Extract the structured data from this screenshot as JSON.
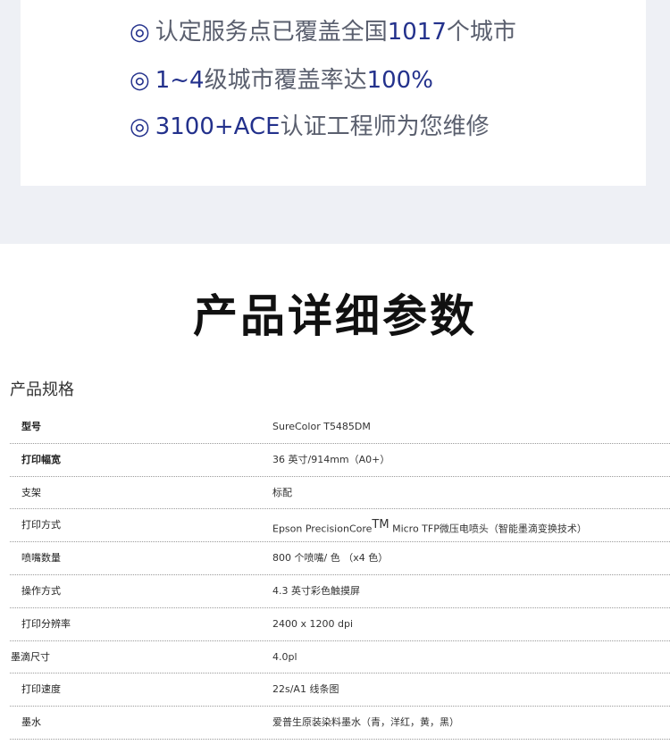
{
  "service": {
    "line1": {
      "mark": "◎",
      "pre": "认定服务点已覆盖全国",
      "num": "1017",
      "post": "个城市"
    },
    "line2": {
      "mark": "◎",
      "pre": "1~4",
      "mid": "级城市覆盖率达",
      "num": "100%"
    },
    "line3": {
      "mark": "◎",
      "pre": "3100+ACE",
      "post": "认证工程师为您维修"
    }
  },
  "section_title": "产品详细参数",
  "spec_heading": "产品规格",
  "specs": [
    {
      "key": "型号",
      "value": "SureColor T5485DM"
    },
    {
      "key": "打印幅宽",
      "value": "36 英寸/914mm（A0+）"
    },
    {
      "key": "支架",
      "value": "标配"
    },
    {
      "key": "打印方式",
      "value_pre": "Epson PrecisionCore",
      "value_sup": "TM",
      "value_post": " Micro TFP微压电喷头（智能墨滴变换技术）"
    },
    {
      "key": "喷嘴数量",
      "value": "800 个喷嘴/ 色 （x4 色）"
    },
    {
      "key": "操作方式",
      "value": "4.3 英寸彩色触摸屏"
    },
    {
      "key": "打印分辨率",
      "value": "2400 x 1200 dpi"
    },
    {
      "key": "墨滴尺寸",
      "value": "4.0pl"
    },
    {
      "key": "打印速度",
      "value": "22s/A1 线条图"
    },
    {
      "key": "墨水",
      "value": "爱普生原装染料墨水（青，洋红，黄，黑）"
    }
  ]
}
